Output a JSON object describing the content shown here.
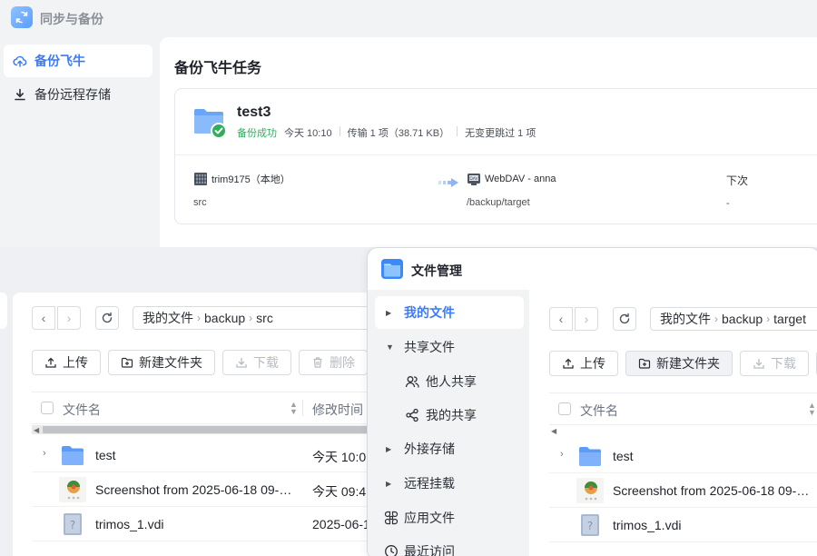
{
  "backup_app": {
    "title": "同步与备份",
    "sidebar": [
      {
        "label": "备份飞牛",
        "active": true,
        "icon": "cloud-upload-icon"
      },
      {
        "label": "备份远程存储",
        "active": false,
        "icon": "download-icon"
      }
    ],
    "main_title": "备份飞牛任务",
    "task": {
      "name": "test3",
      "status": "备份成功",
      "time": "今天 10:10",
      "transfer": "传输 1 项（38.71 KB）",
      "skipped": "无变更跳过 1 项",
      "source_name": "trim9175（本地）",
      "source_path": "src",
      "target_name": "WebDAV - anna",
      "target_path": "/backup/target",
      "next_label": "下次",
      "next_value": "-"
    }
  },
  "file_manager": {
    "title": "文件管理",
    "nav": [
      {
        "label": "我的文件",
        "active": true,
        "type": "collapsed"
      },
      {
        "label": "共享文件",
        "active": false,
        "type": "expanded"
      },
      {
        "label": "他人共享",
        "active": false,
        "type": "child",
        "icon": "users-icon"
      },
      {
        "label": "我的共享",
        "active": false,
        "type": "child",
        "icon": "share-icon"
      },
      {
        "label": "外接存储",
        "active": false,
        "type": "collapsed"
      },
      {
        "label": "远程挂载",
        "active": false,
        "type": "collapsed"
      },
      {
        "label": "应用文件",
        "active": false,
        "type": "icon",
        "icon": "apps-icon"
      },
      {
        "label": "最近访问",
        "active": false,
        "type": "icon",
        "icon": "clock-icon"
      }
    ],
    "left_pane": {
      "breadcrumb": [
        "我的文件",
        "backup",
        "src"
      ],
      "toolbar": {
        "upload": "上传",
        "new_folder": "新建文件夹",
        "download": "下载",
        "delete": "删除"
      },
      "columns": {
        "name": "文件名",
        "modified": "修改时间"
      },
      "rows": [
        {
          "name": "test",
          "modified": "今天 10:0",
          "icon": "folder-icon",
          "expandable": true
        },
        {
          "name": "Screenshot from 2025-06-18 09-…",
          "modified": "今天 09:4",
          "icon": "image-thumb-icon",
          "expandable": false
        },
        {
          "name": "trimos_1.vdi",
          "modified": "2025-06-1",
          "icon": "unknown-file-icon",
          "expandable": false
        }
      ]
    },
    "right_pane": {
      "breadcrumb": [
        "我的文件",
        "backup",
        "target"
      ],
      "toolbar": {
        "upload": "上传",
        "new_folder": "新建文件夹",
        "download": "下载"
      },
      "columns": {
        "name": "文件名"
      },
      "rows": [
        {
          "name": "test",
          "icon": "folder-icon",
          "expandable": true
        },
        {
          "name": "Screenshot from 2025-06-18 09-…",
          "icon": "image-thumb-icon",
          "expandable": false
        },
        {
          "name": "trimos_1.vdi",
          "icon": "unknown-file-icon",
          "expandable": false
        }
      ]
    }
  },
  "colors": {
    "accent": "#3a7afe",
    "success": "#2fae5b",
    "folder": "#5b9cf6"
  }
}
